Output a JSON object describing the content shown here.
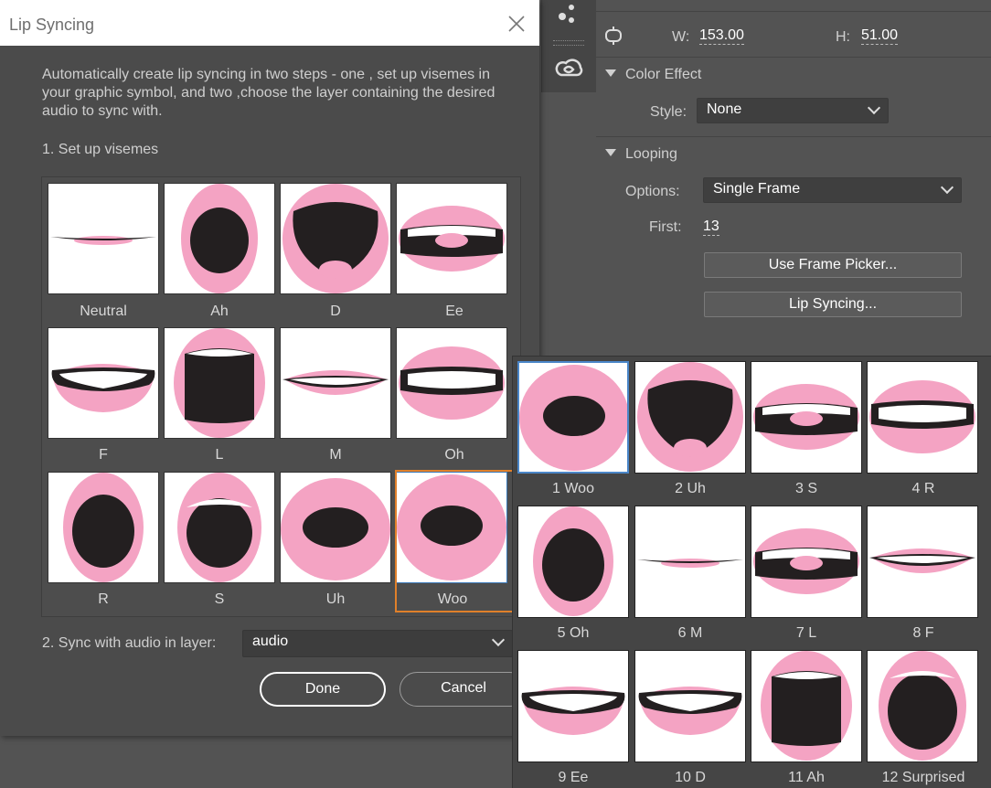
{
  "dialog": {
    "title": "Lip Syncing",
    "description": "Automatically create lip syncing in two steps - one , set up visemes in your graphic symbol, and two ,choose the layer containing the desired audio to sync with.",
    "step1_label": "1. Set up visemes",
    "visemes": [
      "Neutral",
      "Ah",
      "D",
      "Ee",
      "F",
      "L",
      "M",
      "Oh",
      "R",
      "S",
      "Uh",
      "Woo"
    ],
    "selected_viseme": "Woo",
    "step2_label": "2. Sync with audio in layer:",
    "audio_layer_value": "audio",
    "done_label": "Done",
    "cancel_label": "Cancel"
  },
  "properties": {
    "w_label": "W:",
    "w_value": "153.00",
    "h_label": "H:",
    "h_value": "51.00",
    "color_effect_header": "Color Effect",
    "style_label": "Style:",
    "style_value": "None",
    "looping_header": "Looping",
    "options_label": "Options:",
    "options_value": "Single Frame",
    "first_label": "First:",
    "first_value": "13",
    "frame_picker_button": "Use Frame Picker...",
    "lip_syncing_button": "Lip Syncing..."
  },
  "frame_picker": {
    "frames": [
      "1 Woo",
      "2 Uh",
      "3 S",
      "4 R",
      "5 Oh",
      "6 M",
      "7 L",
      "8 F",
      "9 Ee",
      "10 D",
      "11 Ah",
      "12 Surprised"
    ],
    "selected_frame": "1 Woo"
  },
  "colors": {
    "lip_pink": "#f4a3c3",
    "mouth_dark": "#231f20",
    "selection_orange": "#e0802a",
    "panel_bg": "#535353",
    "dialog_bg": "#4b4b4b"
  }
}
